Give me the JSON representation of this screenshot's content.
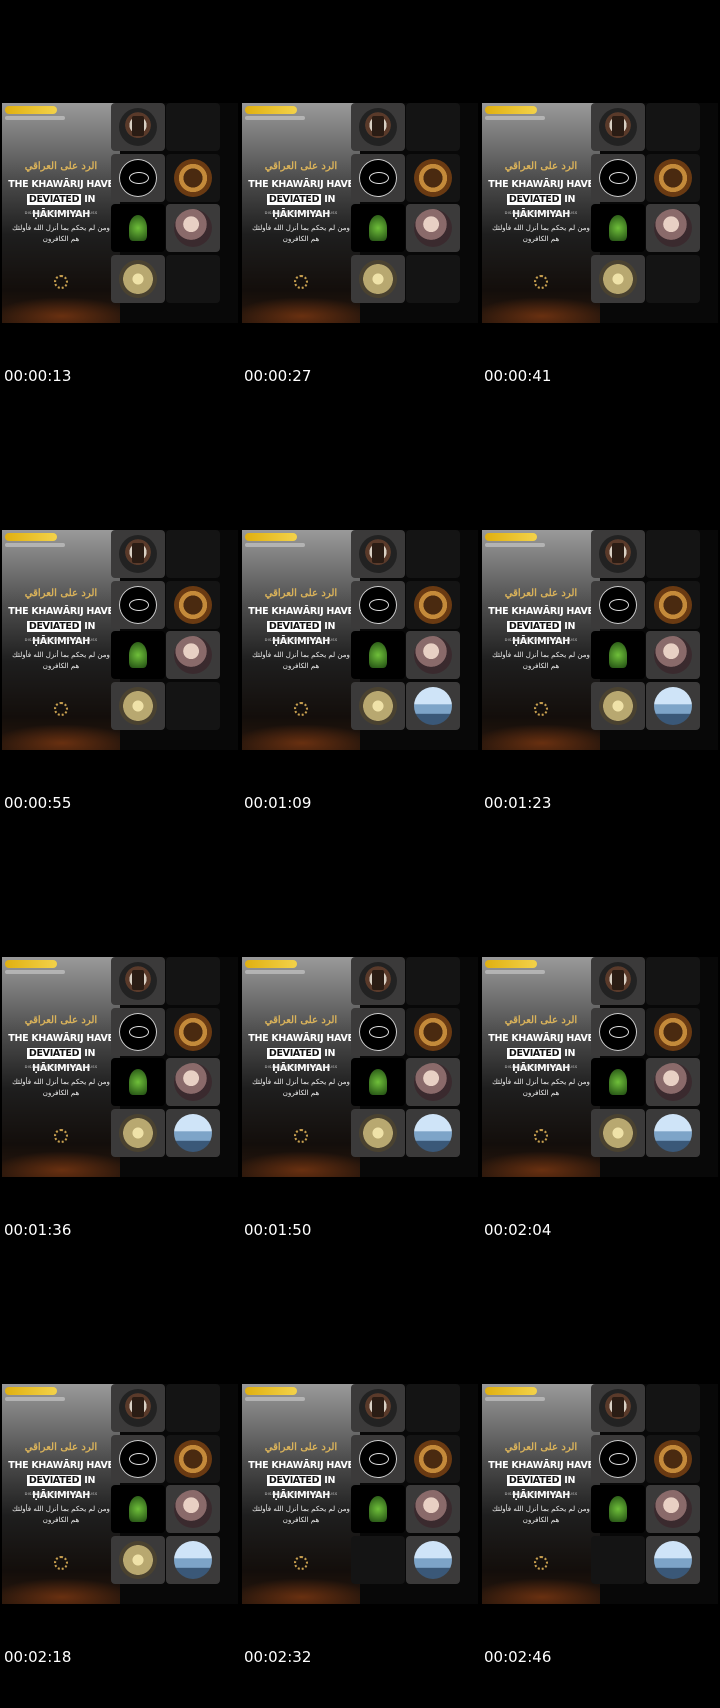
{
  "video": {
    "headline_line1": "THE KHAWĀRIJ HAVE",
    "headline_line2": "DEVIATED IN ḤĀKIMIYAH",
    "highlight_word": "DEVIATED",
    "subtitle": "DISAGREE? COME UP AND DISCUSS",
    "arabic_top": "الرد على العراقي",
    "arabic_verse": "ومن لم يحكم بما أنزل الله فأولئك هم الكافرون"
  },
  "thumbnails": [
    {
      "timestamp": "00:00:13",
      "tiles": [
        1,
        1,
        1,
        1,
        1,
        1,
        0
      ]
    },
    {
      "timestamp": "00:00:27",
      "tiles": [
        1,
        1,
        1,
        1,
        1,
        1,
        0
      ]
    },
    {
      "timestamp": "00:00:41",
      "tiles": [
        1,
        1,
        1,
        1,
        1,
        1,
        0
      ]
    },
    {
      "timestamp": "00:00:55",
      "tiles": [
        1,
        1,
        1,
        1,
        1,
        1,
        0
      ]
    },
    {
      "timestamp": "00:01:09",
      "tiles": [
        1,
        1,
        1,
        1,
        1,
        1,
        1
      ]
    },
    {
      "timestamp": "00:01:23",
      "tiles": [
        1,
        1,
        1,
        1,
        1,
        1,
        1
      ]
    },
    {
      "timestamp": "00:01:36",
      "tiles": [
        1,
        1,
        1,
        1,
        1,
        1,
        1
      ]
    },
    {
      "timestamp": "00:01:50",
      "tiles": [
        1,
        1,
        1,
        1,
        1,
        1,
        1
      ]
    },
    {
      "timestamp": "00:02:04",
      "tiles": [
        1,
        1,
        1,
        1,
        1,
        1,
        1
      ]
    },
    {
      "timestamp": "00:02:18",
      "tiles": [
        1,
        1,
        1,
        1,
        1,
        1,
        1
      ]
    },
    {
      "timestamp": "00:02:32",
      "tiles": [
        1,
        1,
        1,
        1,
        1,
        0,
        1
      ]
    },
    {
      "timestamp": "00:02:46",
      "tiles": [
        1,
        1,
        1,
        1,
        1,
        0,
        1
      ]
    }
  ]
}
